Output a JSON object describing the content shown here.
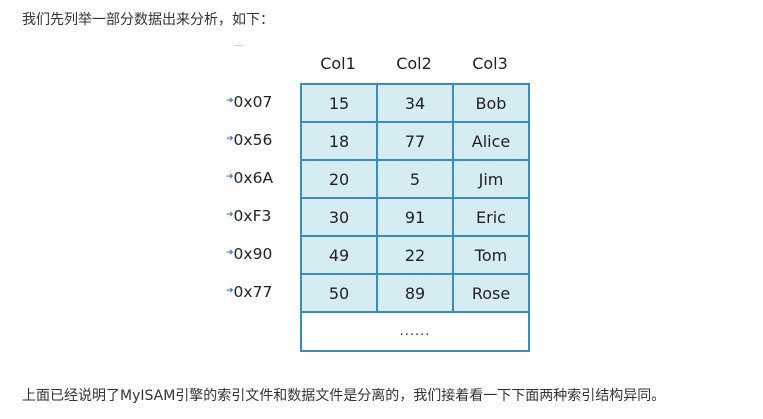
{
  "intro_text": "我们先列举一部分数据出来分析，如下：",
  "figure": {
    "columns": [
      "Col1",
      "Col2",
      "Col3"
    ],
    "rows": [
      {
        "address": "0x07",
        "cells": [
          "15",
          "34",
          "Bob"
        ]
      },
      {
        "address": "0x56",
        "cells": [
          "18",
          "77",
          "Alice"
        ]
      },
      {
        "address": "0x6A",
        "cells": [
          "20",
          "5",
          "Jim"
        ]
      },
      {
        "address": "0xF3",
        "cells": [
          "30",
          "91",
          "Eric"
        ]
      },
      {
        "address": "0x90",
        "cells": [
          "49",
          "22",
          "Tom"
        ]
      },
      {
        "address": "0x77",
        "cells": [
          "50",
          "89",
          "Rose"
        ]
      }
    ],
    "ellipsis": "......",
    "colors": {
      "cell_fill": "#d6ecf3",
      "grid_border": "#3a8cc0",
      "arrow": "#3a7bd5"
    }
  },
  "outro_text": "上面已经说明了MyISAM引擎的索引文件和数据文件是分离的，我们接着看一下下面两种索引结构异同。"
}
